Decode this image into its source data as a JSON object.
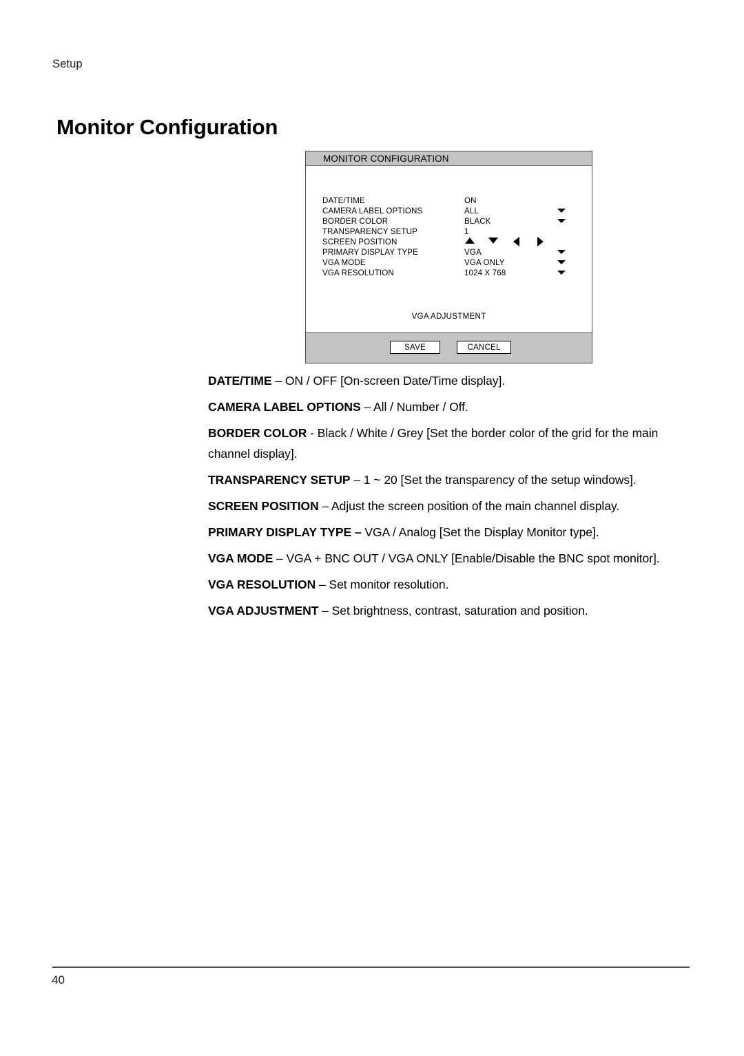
{
  "running_header": "Setup",
  "page_heading": "Monitor Configuration",
  "dialog": {
    "title": "MONITOR CONFIGURATION",
    "rows": [
      {
        "label": "DATE/TIME",
        "value": "ON",
        "control": "none"
      },
      {
        "label": "CAMERA LABEL OPTIONS",
        "value": "ALL",
        "control": "dropdown"
      },
      {
        "label": "BORDER  COLOR",
        "value": "BLACK",
        "control": "dropdown"
      },
      {
        "label": "TRANSPARENCY SETUP",
        "value": "1",
        "control": "none"
      },
      {
        "label": "SCREEN POSITION",
        "value": "",
        "control": "arrows"
      },
      {
        "label": "PRIMARY DISPLAY TYPE",
        "value": "VGA",
        "control": "dropdown"
      },
      {
        "label": "VGA MODE",
        "value": "VGA ONLY",
        "control": "dropdown"
      },
      {
        "label": "VGA RESOLUTION",
        "value": "1024 X 768",
        "control": "dropdown"
      }
    ],
    "arrow_icons": [
      "up-arrow-icon",
      "down-arrow-icon",
      "left-arrow-icon",
      "right-arrow-icon"
    ],
    "dropdown_icon": "chevron-down-icon",
    "vga_adjustment_label": "VGA ADJUSTMENT",
    "save_label": "SAVE",
    "cancel_label": "CANCEL",
    "colors": {
      "titlebar_bg": "#c3c3c3",
      "footer_bg": "#c3c3c3",
      "body_bg": "#ffffff",
      "border": "#4a4a4a"
    }
  },
  "descriptions": [
    {
      "term": "DATE/TIME",
      "rest": " – ON / OFF [On-screen Date/Time display]."
    },
    {
      "term": "CAMERA LABEL OPTIONS",
      "rest": " – All / Number / Off."
    },
    {
      "term": "BORDER COLOR",
      "rest": " - Black / White / Grey [Set the border color of the grid for the main channel display]."
    },
    {
      "term": "TRANSPARENCY SETUP",
      "rest": " – 1 ~ 20 [Set the transparency of the setup windows]."
    },
    {
      "term": "SCREEN POSITION",
      "rest": " – Adjust the screen position of the main channel display."
    },
    {
      "term": "PRIMARY DISPLAY TYPE –",
      "rest": " VGA / Analog [Set the Display Monitor type]."
    },
    {
      "term": "VGA MODE",
      "rest": " – VGA + BNC OUT / VGA ONLY [Enable/Disable the BNC spot monitor]."
    },
    {
      "term": "VGA RESOLUTION",
      "rest": " – Set monitor resolution."
    },
    {
      "term": "VGA ADJUSTMENT",
      "rest": " – Set brightness, contrast, saturation and position."
    }
  ],
  "page_number": "40"
}
